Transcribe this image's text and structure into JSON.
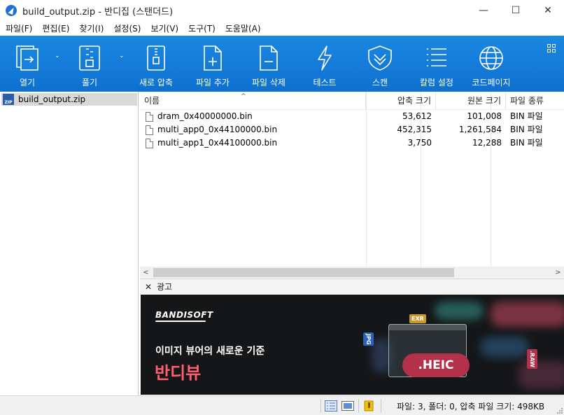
{
  "window": {
    "title": "build_output.zip - 반디집 (스탠더드)",
    "minimize_glyph": "—",
    "maximize_glyph": "☐",
    "close_glyph": "✕"
  },
  "menu": [
    "파일(F)",
    "편집(E)",
    "찾기(I)",
    "설정(S)",
    "보기(V)",
    "도구(T)",
    "도움말(A)"
  ],
  "toolbar": {
    "open": "열기",
    "extract": "풀기",
    "new_archive": "새로 압축",
    "add_file": "파일 추가",
    "delete_file": "파일 삭제",
    "test": "테스트",
    "scan": "스캔",
    "column_settings": "칼럼 설정",
    "codepage": "코드페이지",
    "caret": "⌄"
  },
  "tree": {
    "root": "build_output.zip",
    "root_icon_text": "ZIP"
  },
  "columns": {
    "name": "이름",
    "compressed": "압축 크기",
    "original": "원본 크기",
    "type": "파일 종류",
    "sort_indicator": "^"
  },
  "files": [
    {
      "name": "dram_0x40000000.bin",
      "compressed": "53,612",
      "original": "101,008",
      "type": "BIN 파일"
    },
    {
      "name": "multi_app0_0x44100000.bin",
      "compressed": "452,315",
      "original": "1,261,584",
      "type": "BIN 파일"
    },
    {
      "name": "multi_app1_0x44100000.bin",
      "compressed": "3,750",
      "original": "12,288",
      "type": "BIN 파일"
    }
  ],
  "scrollbar": {
    "left": "<",
    "right": ">"
  },
  "ad": {
    "close": "✕",
    "label": "광고",
    "logo": "BANDISOFT",
    "tagline": "이미지 뷰어의 새로운 기준",
    "brand": "반디뷰",
    "format_badge": ".HEIC",
    "tag_raw": ".RAW",
    "tag_exr": "EXR",
    "tag_jpg": "JPG"
  },
  "status": {
    "text": "파일: 3, 폴더: 0, 압축 파일 크기: 498KB"
  },
  "colors": {
    "toolbar": "#1384db",
    "brand_accent": "#ff5f6e",
    "heic_badge": "#b3314a"
  }
}
